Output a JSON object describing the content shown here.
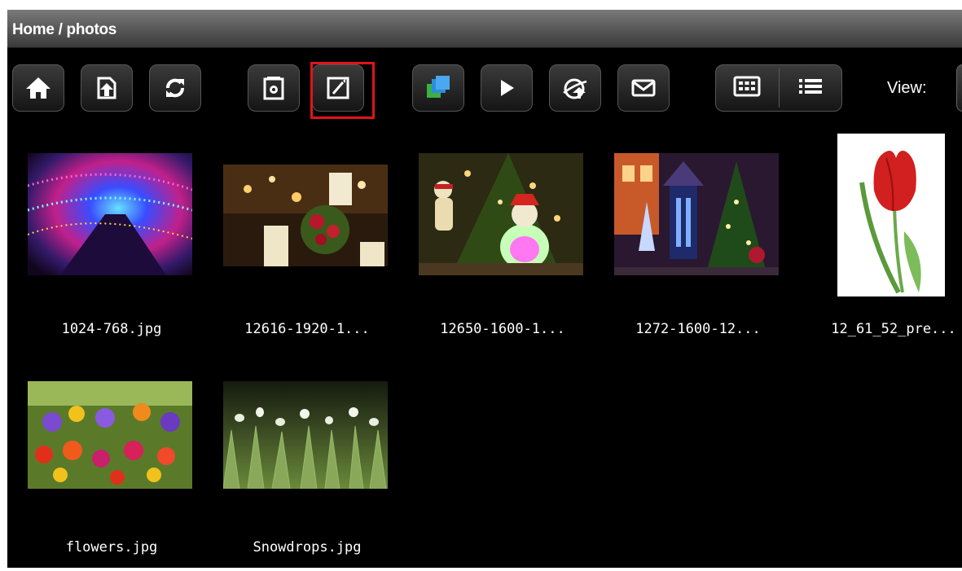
{
  "breadcrumb": "Home / photos",
  "toolbar": {
    "view_label": "View:"
  },
  "icons": [
    "home-icon",
    "upload-icon",
    "refresh-icon",
    "settings-icon",
    "edit-icon",
    "copy-icon",
    "play-icon",
    "share-icon",
    "mail-icon",
    "grid-view-icon",
    "list-view-icon"
  ],
  "colors": {
    "highlight": "#e0141b",
    "background": "#000000"
  },
  "files": [
    {
      "name": "1024-768.jpg"
    },
    {
      "name": "12616-1920-1..."
    },
    {
      "name": "12650-1600-1..."
    },
    {
      "name": "1272-1600-12..."
    },
    {
      "name": "12_61_52_pre..."
    },
    {
      "name": "flowers.jpg"
    },
    {
      "name": "Snowdrops.jpg"
    }
  ]
}
